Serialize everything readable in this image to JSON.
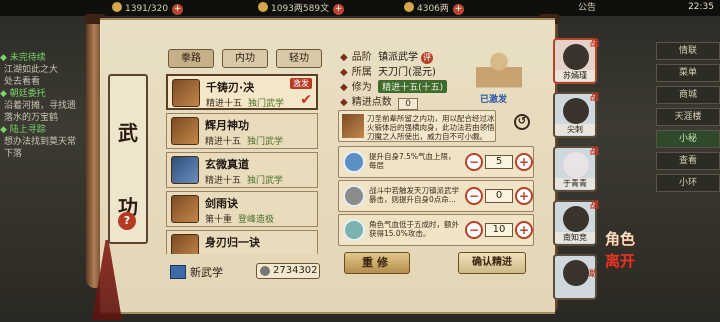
{
  "topbar": {
    "res1": "1391/320",
    "res2": "1093两589文",
    "res3": "4306两",
    "notice": "公告",
    "time": "22:35"
  },
  "quests": [
    {
      "title": "◆ 未完待续",
      "lines": [
        "江湖如此之大",
        "处去看看"
      ]
    },
    {
      "title": "◆ 朝廷委托",
      "lines": [
        "沿着河摊，寻找遗",
        "落水的万宝鹤"
      ]
    },
    {
      "title": "◆ 陆上寻踪",
      "lines": [
        "想办法找到莫天常",
        "下落"
      ]
    }
  ],
  "right_menu": [
    "情联",
    "菜单",
    "商城",
    "天涯楼",
    "小秘",
    "查看",
    "小环"
  ],
  "banner": {
    "line1": "武",
    "line2": "功",
    "help": "?"
  },
  "tabs": [
    "拳路",
    "内功",
    "轻功"
  ],
  "skills": [
    {
      "name": "千铸刃·决",
      "level": "精进十五",
      "type": "独门武学",
      "badge": "激发",
      "checked": "✔"
    },
    {
      "name": "辉月神功",
      "level": "精进十五",
      "type": "独门武学"
    },
    {
      "name": "玄微真道",
      "level": "精进十五",
      "type": "独门武学"
    },
    {
      "name": "剑雨诀",
      "level": "第十重",
      "type": "登峰造极"
    },
    {
      "name": "身刃归一诀",
      "level": "",
      "type": ""
    }
  ],
  "new_skill_label": "新武学",
  "points_value": "2734302",
  "detail": {
    "grade_label": "品阶",
    "grade_value": "镇派武学",
    "grade_tag": "评",
    "school_label": "所属",
    "school_value": "天刀门(混元)",
    "cultivation_label": "修为",
    "cultivation_value": "精进十五(十五)",
    "refine_label": "精进点数",
    "refine_value": "0",
    "figure_label": "已激发",
    "description": "刀圣前辈所留之内功，用以配合经过冰火锻体后的强横肉身，此功法若由领悟刀魔之人所使出，威力自不可小觑。"
  },
  "effects": [
    {
      "text": "提升自身7.5%气血上限，每层",
      "value": "5",
      "icon": "blue-drop-icon"
    },
    {
      "text": "战斗中若触发天刀镇派武学暴击，则提升自身0点命...",
      "value": "0",
      "icon": "figure-icon"
    },
    {
      "text": "角色气血低于五成时，额外获得15.0%攻击。",
      "value": "10",
      "icon": "teal-drop-icon"
    }
  ],
  "buttons": {
    "reset": "重修",
    "confirm": "确认精进"
  },
  "characters": [
    {
      "name": "苏嫣瑾",
      "tag": "战"
    },
    {
      "name": "尖刺",
      "tag": "战"
    },
    {
      "name": "于青青",
      "tag": "战"
    },
    {
      "name": "南知竞",
      "tag": "战"
    },
    {
      "name": "",
      "tag": "助"
    }
  ],
  "side_label": {
    "line1": "角色",
    "line2": "离开"
  }
}
